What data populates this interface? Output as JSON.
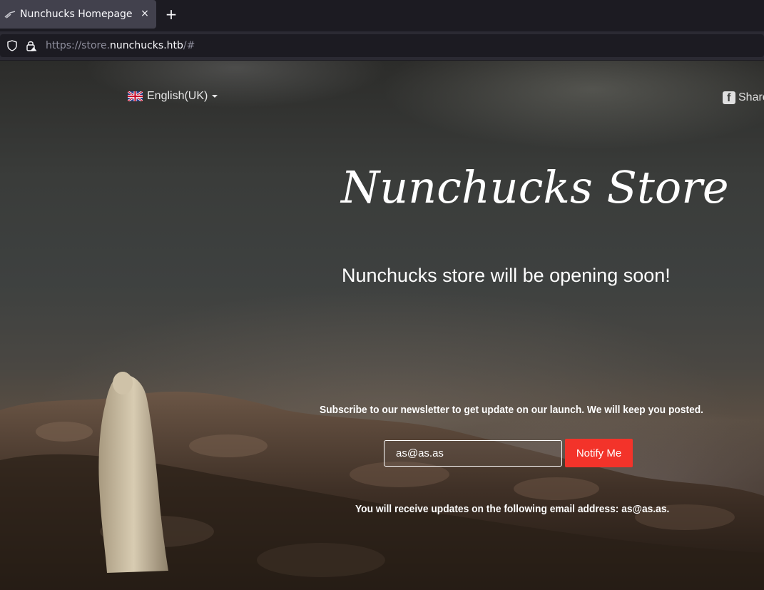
{
  "browser": {
    "tab_title": "Nunchucks Homepage",
    "tab_close": "×",
    "new_tab": "+",
    "url_prefix": "https://store.",
    "url_host": "nunchucks.htb",
    "url_suffix": "/#"
  },
  "header": {
    "language": "English(UK)",
    "share": "Share",
    "icons": [
      "uk-flag-icon",
      "caret-down-icon",
      "facebook-icon"
    ]
  },
  "hero": {
    "title": "Nunchucks Store",
    "subtitle": "Nunchucks store will be opening soon!"
  },
  "newsletter": {
    "prompt": "Subscribe to our newsletter to get update on our launch. We will keep you posted.",
    "email_value": "as@as.as",
    "button_label": "Notify Me",
    "confirmation": "You will receive updates on the following email address: as@as.as."
  },
  "colors": {
    "accent": "#f3332a",
    "text": "#ffffff"
  }
}
